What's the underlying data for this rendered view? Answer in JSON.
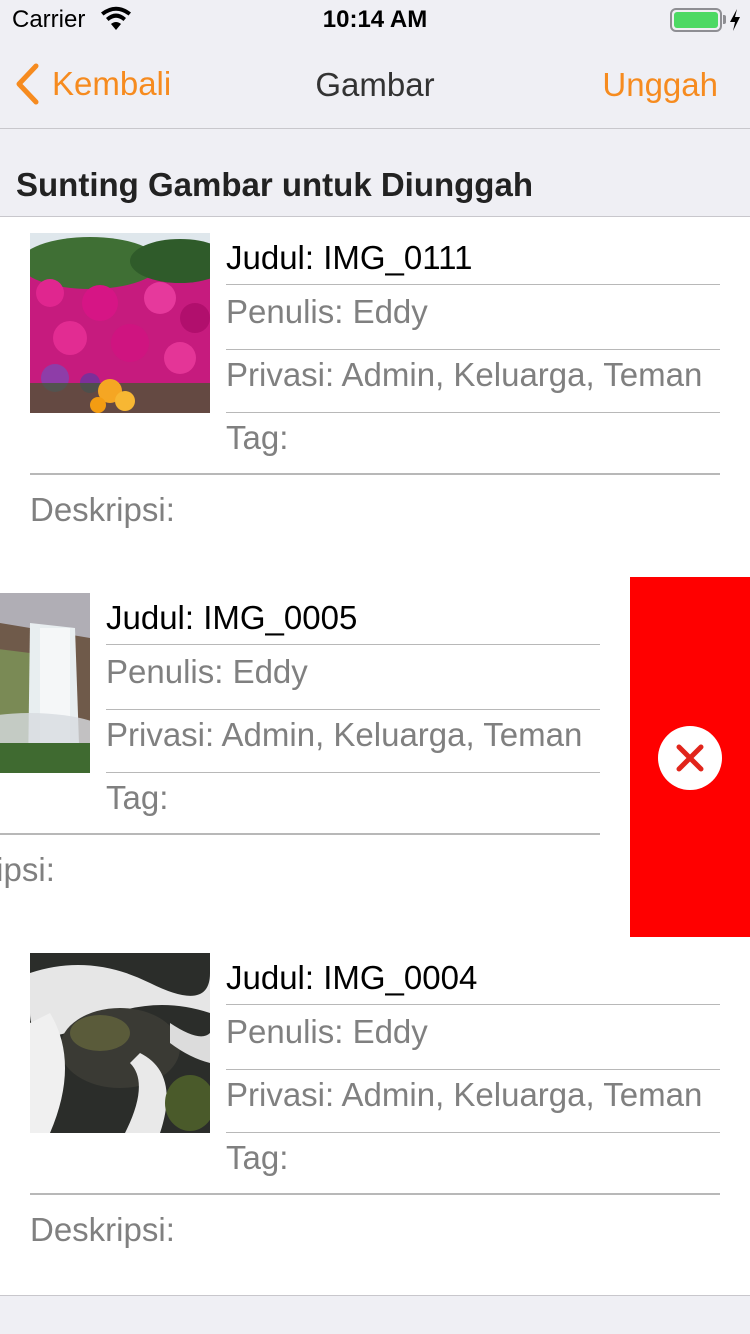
{
  "status_bar": {
    "carrier": "Carrier",
    "time": "10:14 AM",
    "battery_level": 1.0
  },
  "nav": {
    "back_label": "Kembali",
    "title": "Gambar",
    "action_label": "Unggah",
    "accent_color": "#f68b1f"
  },
  "section": {
    "header": "Sunting Gambar untuk Diunggah"
  },
  "rows": [
    {
      "title": "Judul: IMG_0111",
      "author": "Penulis: Eddy",
      "privacy": "Privasi: Admin, Keluarga, Teman",
      "tags": "Tag:",
      "description": "Deskripsi:",
      "thumbnail": "pink-flowers-photo"
    },
    {
      "title": "Judul: IMG_0005",
      "author": "Penulis: Eddy",
      "privacy": "Privasi: Admin, Keluarga, Teman",
      "tags": "Tag:",
      "description": "Deskripsi:",
      "thumbnail": "waterfall-photo",
      "swiped": true
    },
    {
      "title": "Judul: IMG_0004",
      "author": "Penulis: Eddy",
      "privacy": "Privasi: Admin, Keluarga, Teman",
      "tags": "Tag:",
      "description": "Deskripsi:",
      "thumbnail": "stream-rocks-photo"
    }
  ],
  "delete_action": {
    "icon": "close-icon",
    "color": "#ff0000"
  }
}
